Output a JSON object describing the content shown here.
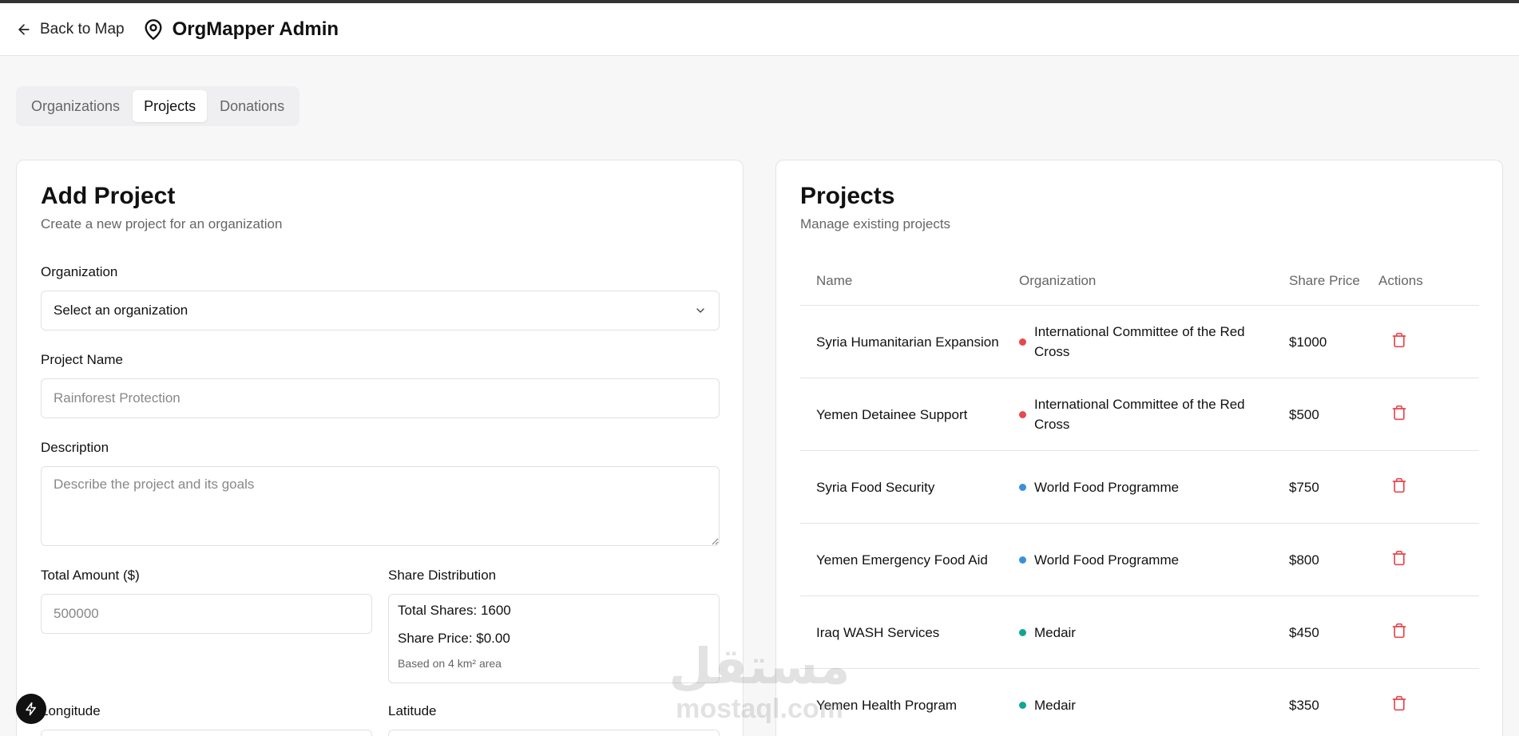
{
  "header": {
    "back_label": "Back to Map",
    "app_title": "OrgMapper Admin"
  },
  "tabs": [
    {
      "label": "Organizations",
      "active": false
    },
    {
      "label": "Projects",
      "active": true
    },
    {
      "label": "Donations",
      "active": false
    }
  ],
  "add_project": {
    "title": "Add Project",
    "subtitle": "Create a new project for an organization",
    "organization_label": "Organization",
    "organization_value": "Select an organization",
    "project_name_label": "Project Name",
    "project_name_placeholder": "Rainforest Protection",
    "description_label": "Description",
    "description_placeholder": "Describe the project and its goals",
    "total_amount_label": "Total Amount ($)",
    "total_amount_placeholder": "500000",
    "share_distribution_label": "Share Distribution",
    "total_shares": "Total Shares: 1600",
    "share_price": "Share Price: $0.00",
    "share_note": "Based on 4 km² area",
    "longitude_label": "Longitude",
    "latitude_label": "Latitude"
  },
  "projects": {
    "title": "Projects",
    "subtitle": "Manage existing projects",
    "columns": {
      "name": "Name",
      "organization": "Organization",
      "share_price": "Share Price",
      "actions": "Actions"
    },
    "rows": [
      {
        "name": "Syria Humanitarian Expansion",
        "organization": "International Committee of the Red Cross",
        "org_color": "#e5484d",
        "price": "$1000"
      },
      {
        "name": "Yemen Detainee Support",
        "organization": "International Committee of the Red Cross",
        "org_color": "#e5484d",
        "price": "$500"
      },
      {
        "name": "Syria Food Security",
        "organization": "World Food Programme",
        "org_color": "#3b8fdd",
        "price": "$750"
      },
      {
        "name": "Yemen Emergency Food Aid",
        "organization": "World Food Programme",
        "org_color": "#3b8fdd",
        "price": "$800"
      },
      {
        "name": "Iraq WASH Services",
        "organization": "Medair",
        "org_color": "#12a594",
        "price": "$450"
      },
      {
        "name": "Yemen Health Program",
        "organization": "Medair",
        "org_color": "#12a594",
        "price": "$350"
      }
    ]
  },
  "colors": {
    "delete": "#e5484d"
  },
  "icons": {
    "back": "arrow-left-icon",
    "brand": "map-pin-icon",
    "select": "chevron-down-icon",
    "delete": "trash-icon",
    "fab": "lightning-bolt-icon"
  },
  "watermark": {
    "arabic": "مستقل",
    "latin": "mostaql.com"
  }
}
